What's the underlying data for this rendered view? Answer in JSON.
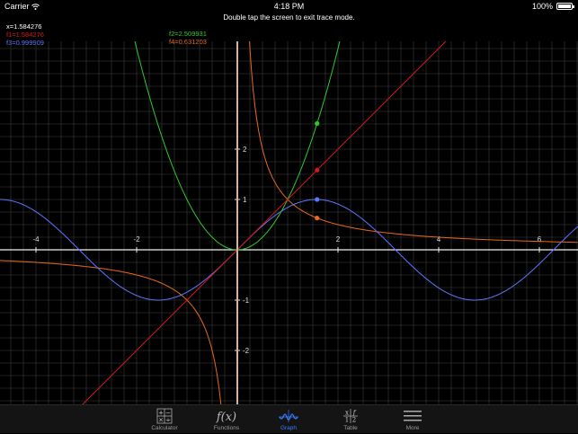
{
  "status_bar": {
    "carrier": "Carrier",
    "time": "4:18 PM",
    "battery": "100%"
  },
  "hint": "Double tap the screen to exit trace mode.",
  "trace": {
    "x": "x=1.584276",
    "f1": "f1=1.584276",
    "f2": "f2=2.509931",
    "f3": "f3=0.999909",
    "f4": "f4=0.631203"
  },
  "colors": {
    "f1": "#d21a1a",
    "f2": "#2ec82e",
    "f3": "#5a78ff",
    "f4": "#e8691e",
    "grid": "#3e3e3e",
    "axis": "#f0f0f0",
    "active_tab": "#3a7dff"
  },
  "graph": {
    "x_ticks": [
      "-4",
      "-2",
      "2",
      "4",
      "6"
    ],
    "y_ticks": [
      "2",
      "1",
      "-1",
      "-2"
    ],
    "trace_x": 1.584276,
    "functions": [
      "x",
      "x^2",
      "sin(x)",
      "1/x"
    ]
  },
  "tabs": [
    {
      "label": "Calculator",
      "icon": "calculator-icon"
    },
    {
      "label": "Functions",
      "icon": "function-icon"
    },
    {
      "label": "Graph",
      "icon": "graph-wave-icon",
      "active": true
    },
    {
      "label": "Table",
      "icon": "table-icon"
    },
    {
      "label": "More",
      "icon": "menu-icon"
    }
  ]
}
